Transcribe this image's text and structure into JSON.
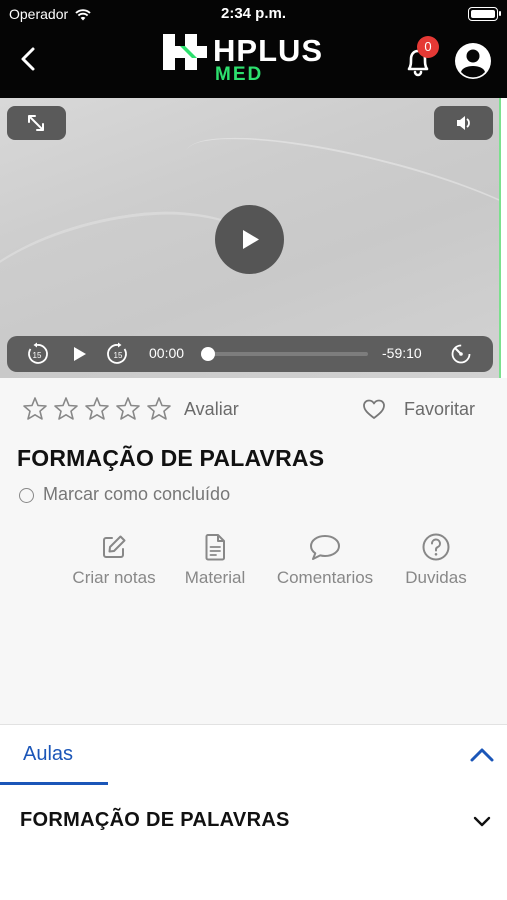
{
  "status_bar": {
    "carrier": "Operador",
    "time": "2:34 p.m."
  },
  "header": {
    "logo_word": "HPLUS",
    "logo_sub": "MED",
    "notification_count": "0"
  },
  "player": {
    "current_time": "00:00",
    "remaining_time": "-59:10",
    "progress": 0
  },
  "lesson_info": {
    "rate_label": "Avaliar",
    "favorite_label": "Favoritar",
    "title": "FORMAÇÃO DE PALAVRAS",
    "mark_done_label": "Marcar como concluído",
    "actions": [
      {
        "label": "Criar notas",
        "icon": "edit-icon"
      },
      {
        "label": "Material",
        "icon": "document-icon"
      },
      {
        "label": "Comentarios",
        "icon": "comment-icon"
      },
      {
        "label": "Duvidas",
        "icon": "help-icon"
      }
    ]
  },
  "tabs": {
    "active_label": "Aulas"
  },
  "lessons": [
    {
      "title": "FORMAÇÃO DE PALAVRAS"
    }
  ],
  "colors": {
    "header_bg": "#050505",
    "brand_green": "#2de06e",
    "accent_blue": "#1b56b8",
    "badge_red": "#e53935"
  }
}
